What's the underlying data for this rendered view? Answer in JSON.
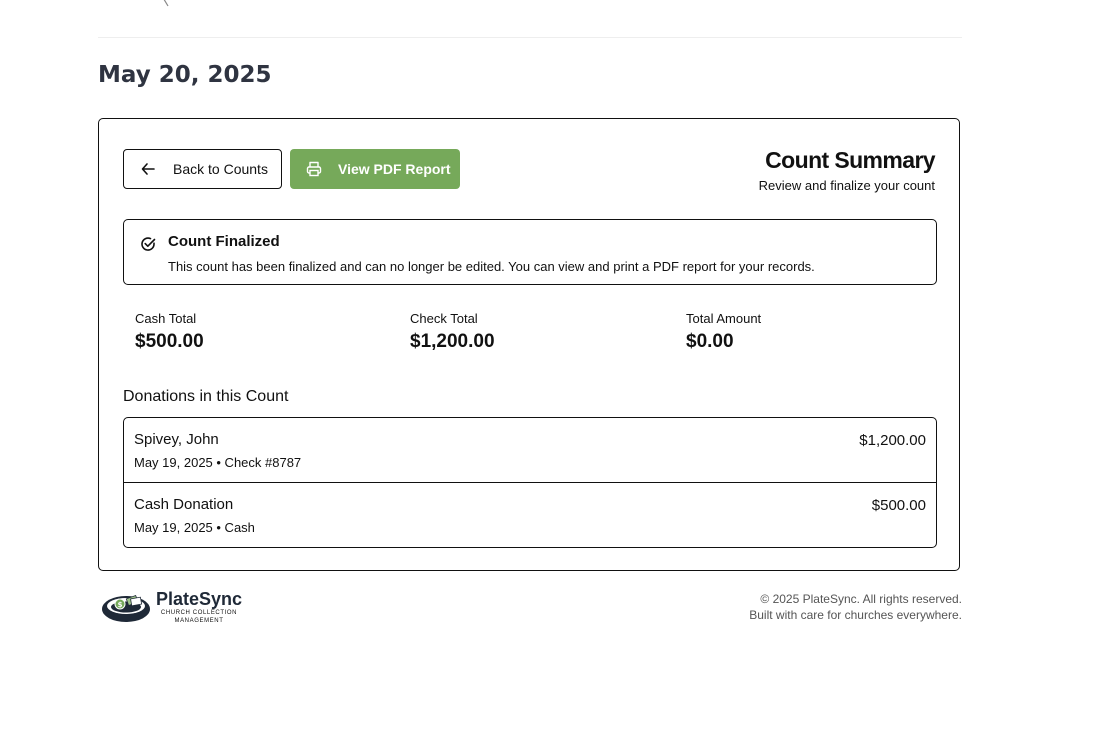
{
  "page": {
    "date_heading": "May 20, 2025"
  },
  "actions": {
    "back_label": "Back to Counts",
    "pdf_label": "View PDF Report",
    "back_icon": "arrow-left-icon",
    "pdf_icon": "printer-icon"
  },
  "summary": {
    "title": "Count Summary",
    "subtitle": "Review and finalize your count"
  },
  "alert": {
    "icon": "check-circle-icon",
    "title": "Count Finalized",
    "message": "This count has been finalized and can no longer be edited. You can view and print a PDF report for your records."
  },
  "totals": {
    "cash_label": "Cash Total",
    "cash_value": "$500.00",
    "check_label": "Check Total",
    "check_value": "$1,200.00",
    "total_label": "Total Amount",
    "total_value": "$0.00"
  },
  "donations": {
    "heading": "Donations in this Count",
    "items": [
      {
        "donor": "Spivey, John",
        "meta": "May 19, 2025 • Check #8787",
        "amount": "$1,200.00"
      },
      {
        "donor": "Cash Donation",
        "meta": "May 19, 2025 • Cash",
        "amount": "$500.00"
      }
    ]
  },
  "footer": {
    "brand_name": "PlateSync",
    "brand_tagline_line1": "CHURCH COLLECTION",
    "brand_tagline_line2": "MANAGEMENT",
    "copyright": "© 2025 PlateSync. All rights reserved.",
    "tagline": "Built with care for churches everywhere."
  },
  "colors": {
    "primary_green": "#76a95a",
    "heading_slate": "#2f3441",
    "logo_navy": "#1f2937"
  }
}
